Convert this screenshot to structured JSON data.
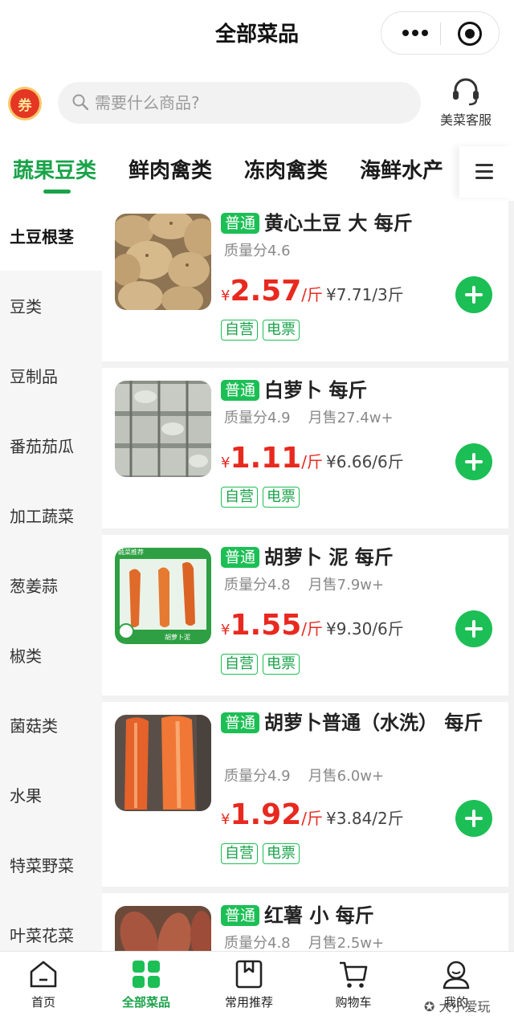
{
  "title": "全部菜品",
  "coupon_label": "券",
  "search": {
    "placeholder": "需要什么商品?"
  },
  "service_label": "美菜客服",
  "tabs": [
    {
      "label": "蔬果豆类",
      "active": true
    },
    {
      "label": "鲜肉禽类",
      "active": false
    },
    {
      "label": "冻肉禽类",
      "active": false
    },
    {
      "label": "海鲜水产",
      "active": false
    }
  ],
  "sidebar": [
    {
      "label": "土豆根茎",
      "active": true
    },
    {
      "label": "豆类"
    },
    {
      "label": "豆制品"
    },
    {
      "label": "番茄茄瓜"
    },
    {
      "label": "加工蔬菜"
    },
    {
      "label": "葱姜蒜"
    },
    {
      "label": "椒类"
    },
    {
      "label": "菌菇类"
    },
    {
      "label": "水果"
    },
    {
      "label": "特菜野菜"
    },
    {
      "label": "叶菜花菜"
    }
  ],
  "products": [
    {
      "badge": "普通",
      "name": "黄心土豆 大 每斤",
      "quality": "质量分4.6",
      "sales": "",
      "yen": "¥",
      "price": "2.57",
      "unit": "/斤",
      "orig": "¥7.71/3斤",
      "tags": [
        "自营",
        "电票"
      ]
    },
    {
      "badge": "普通",
      "name": "白萝卜 每斤",
      "quality": "质量分4.9",
      "sales": "月售27.4w+",
      "yen": "¥",
      "price": "1.11",
      "unit": "/斤",
      "orig": "¥6.66/6斤",
      "tags": [
        "自营",
        "电票"
      ]
    },
    {
      "badge": "普通",
      "name": "胡萝卜 泥 每斤",
      "quality": "质量分4.8",
      "sales": "月售7.9w+",
      "yen": "¥",
      "price": "1.55",
      "unit": "/斤",
      "orig": "¥9.30/6斤",
      "tags": [
        "自营",
        "电票"
      ]
    },
    {
      "badge": "普通",
      "name": "胡萝卜普通（水洗） 每斤",
      "quality": "质量分4.9",
      "sales": "月售6.0w+",
      "yen": "¥",
      "price": "1.92",
      "unit": "/斤",
      "orig": "¥3.84/2斤",
      "tags": [
        "自营",
        "电票"
      ]
    },
    {
      "badge": "普通",
      "name": "红薯 小 每斤",
      "quality": "质量分4.8",
      "sales": "月售2.5w+",
      "yen": "",
      "price": "",
      "unit": "",
      "orig": "",
      "tags": []
    }
  ],
  "thumb_labels": {
    "carrot_top": "蔬菜推荐",
    "carrot_bottom": "胡萝卜泥"
  },
  "bottom_nav": [
    {
      "label": "首页",
      "icon": "home-icon",
      "active": false
    },
    {
      "label": "全部菜品",
      "icon": "grid-icon",
      "active": true
    },
    {
      "label": "常用推荐",
      "icon": "bookmark-icon",
      "active": false
    },
    {
      "label": "购物车",
      "icon": "cart-icon",
      "active": false
    },
    {
      "label": "我的",
      "icon": "user-icon",
      "active": false
    }
  ],
  "watermark": "大小爱玩",
  "colors": {
    "accent": "#1cbf55",
    "accent_text": "#1aa34a",
    "price": "#e8291f"
  }
}
